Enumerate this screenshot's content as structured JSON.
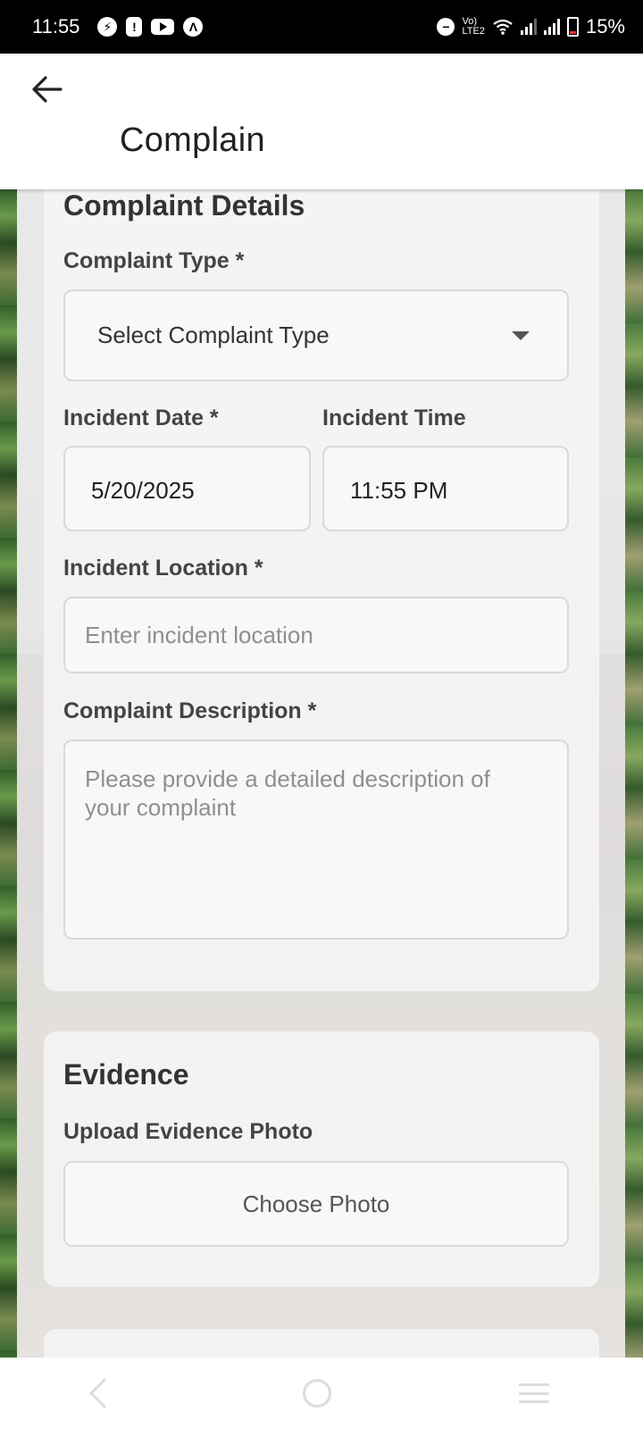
{
  "status_bar": {
    "time": "11:55",
    "battery": "15%",
    "network_small_top": "Vo)",
    "network_small_bottom": "LTE2"
  },
  "app_bar": {
    "title": "Complain",
    "back_icon": "arrow-left-icon"
  },
  "complaint_details": {
    "section_title": "Complaint Details",
    "type_label": "Complaint Type *",
    "type_value": "Select Complaint Type",
    "date_label": "Incident Date *",
    "date_value": "5/20/2025",
    "time_label": "Incident Time",
    "time_value": "11:55 PM",
    "location_label": "Incident Location *",
    "location_placeholder": "Enter incident location",
    "description_label": "Complaint Description *",
    "description_placeholder": "Please provide a detailed description of your complaint"
  },
  "evidence": {
    "section_title": "Evidence",
    "upload_label": "Upload Evidence Photo",
    "choose_photo": "Choose Photo"
  },
  "colors": {
    "status_bar_bg": "#000000",
    "app_bar_bg": "#ffffff",
    "card_bg": "#f5f4f4",
    "text_dark": "#333333",
    "placeholder": "#8f8f8f"
  }
}
